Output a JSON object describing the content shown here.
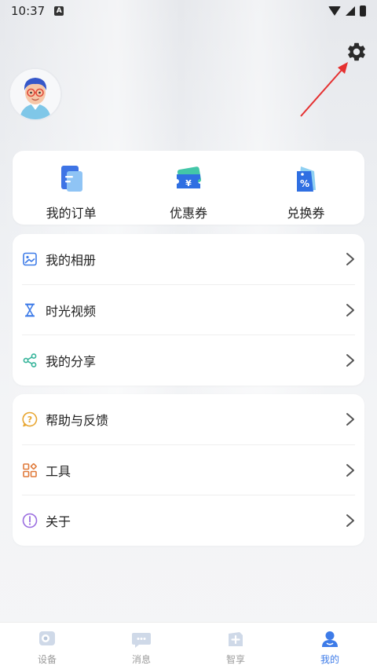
{
  "status_bar": {
    "time": "10:37",
    "notification_letter": "A"
  },
  "quick_actions": [
    {
      "label": "我的订单",
      "icon": "order-icon"
    },
    {
      "label": "优惠券",
      "icon": "coupon-icon"
    },
    {
      "label": "兑换券",
      "icon": "voucher-icon"
    }
  ],
  "menu_group_a": [
    {
      "label": "我的相册",
      "icon": "album-icon"
    },
    {
      "label": "时光视频",
      "icon": "hourglass-icon"
    },
    {
      "label": "我的分享",
      "icon": "share-icon"
    }
  ],
  "menu_group_b": [
    {
      "label": "帮助与反馈",
      "icon": "help-icon"
    },
    {
      "label": "工具",
      "icon": "tools-icon"
    },
    {
      "label": "关于",
      "icon": "about-icon"
    }
  ],
  "bottom_nav": [
    {
      "label": "设备",
      "icon": "device-icon",
      "active": false
    },
    {
      "label": "消息",
      "icon": "message-icon",
      "active": false
    },
    {
      "label": "智享",
      "icon": "smart-share-icon",
      "active": false
    },
    {
      "label": "我的",
      "icon": "profile-icon",
      "active": true
    }
  ],
  "colors": {
    "accent": "#3d7be8",
    "inactive_nav": "#9a9a9a",
    "annotation_arrow": "#e53030"
  }
}
